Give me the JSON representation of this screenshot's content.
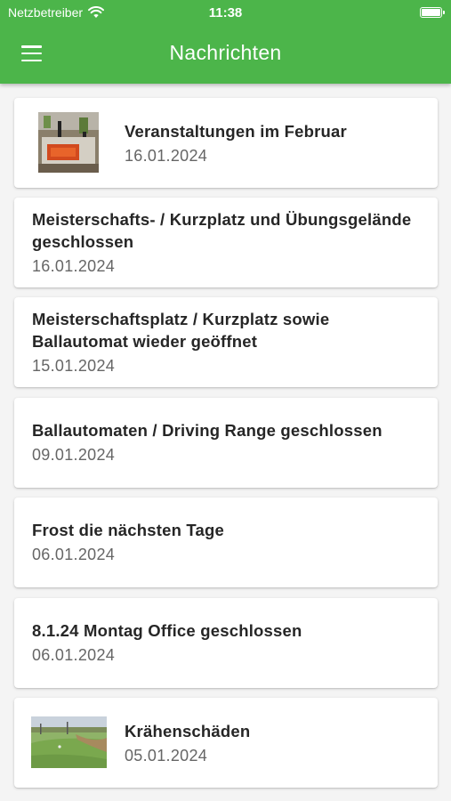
{
  "status_bar": {
    "carrier": "Netzbetreiber",
    "time": "11:38",
    "icons": [
      "wifi-icon",
      "battery-icon"
    ]
  },
  "header": {
    "title": "Nachrichten",
    "menu_icon": "hamburger-menu-icon",
    "background": "#4cb54a"
  },
  "news": [
    {
      "title": "Veranstaltungen im Februar",
      "date": "16.01.2024",
      "has_image": true
    },
    {
      "title": "Meisterschafts- / Kurzplatz und Übungsgelände geschlossen",
      "date": "16.01.2024",
      "has_image": false
    },
    {
      "title": "Meisterschaftsplatz / Kurzplatz sowie Ballautomat wieder geöffnet",
      "date": "15.01.2024",
      "has_image": false
    },
    {
      "title": "Ballautomaten / Driving Range geschlossen",
      "date": "09.01.2024",
      "has_image": false
    },
    {
      "title": "Frost die nächsten Tage",
      "date": "06.01.2024",
      "has_image": false
    },
    {
      "title": "8.1.24 Montag Office geschlossen",
      "date": "06.01.2024",
      "has_image": false
    },
    {
      "title": "Krähenschäden",
      "date": "05.01.2024",
      "has_image": true
    }
  ]
}
